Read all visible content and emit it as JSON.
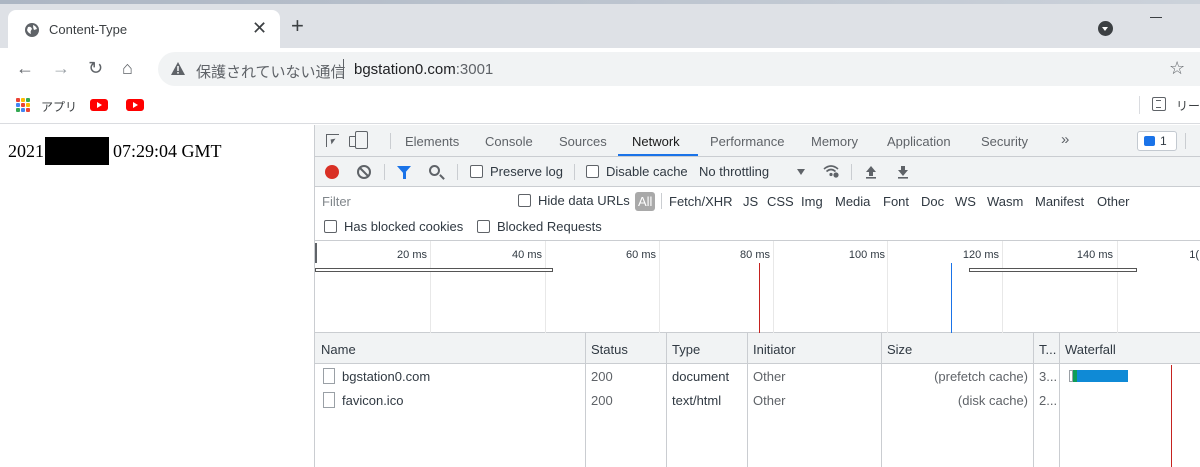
{
  "tab": {
    "title": "Content-Type",
    "close": "✕",
    "newtab": "+"
  },
  "toolbar": {
    "back": "←",
    "forward": "→",
    "reload": "↻",
    "home": "⌂",
    "security_text": "保護されていない通信",
    "host": "bgstation0.com",
    "port": ":3001",
    "star": "☆"
  },
  "bookmarks": {
    "apps_label": "アプリ",
    "reading_list": "リーデ"
  },
  "page": {
    "date_prefix": "2021",
    "date_suffix": "07:29:04 GMT"
  },
  "devtools": {
    "tabs": [
      "Elements",
      "Console",
      "Sources",
      "Network",
      "Performance",
      "Memory",
      "Application",
      "Security"
    ],
    "more": "»",
    "issues_count": "1",
    "preserve_log": "Preserve log",
    "disable_cache": "Disable cache",
    "throttling": "No throttling",
    "filter_placeholder": "Filter",
    "hide_data_urls": "Hide data URLs",
    "types": [
      "All",
      "Fetch/XHR",
      "JS",
      "CSS",
      "Img",
      "Media",
      "Font",
      "Doc",
      "WS",
      "Wasm",
      "Manifest",
      "Other"
    ],
    "has_blocked_cookies": "Has blocked cookies",
    "blocked_requests": "Blocked Requests",
    "overview_ticks": [
      "20 ms",
      "40 ms",
      "60 ms",
      "80 ms",
      "100 ms",
      "120 ms",
      "140 ms",
      "1("
    ],
    "columns": [
      "Name",
      "Status",
      "Type",
      "Initiator",
      "Size",
      "T...",
      "Waterfall"
    ],
    "rows": [
      {
        "name": "bgstation0.com",
        "status": "200",
        "type": "document",
        "initiator": "Other",
        "size": "(prefetch cache)",
        "time": "3..."
      },
      {
        "name": "favicon.ico",
        "status": "200",
        "type": "text/html",
        "initiator": "Other",
        "size": "(disk cache)",
        "time": "2..."
      }
    ]
  },
  "colors": {
    "accent": "#1a73e8",
    "record": "#d93025",
    "waterfall": "#0f8ad6"
  }
}
